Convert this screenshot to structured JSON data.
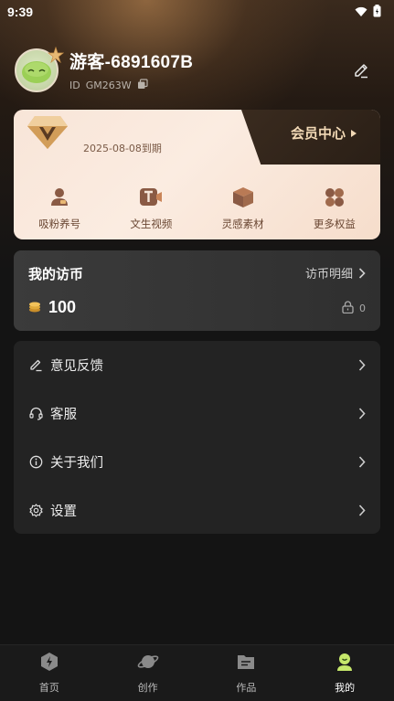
{
  "status_bar": {
    "time": "9:39"
  },
  "profile": {
    "username": "游客-6891607B",
    "id_label": "ID",
    "id_value": "GM263W"
  },
  "vip": {
    "center_label": "会员中心",
    "expire": "2025-08-08到期",
    "features": [
      {
        "label": "吸粉养号",
        "icon": "user-card-icon"
      },
      {
        "label": "文生视频",
        "icon": "text-video-icon"
      },
      {
        "label": "灵感素材",
        "icon": "box-icon"
      },
      {
        "label": "更多权益",
        "icon": "clover-icon"
      }
    ]
  },
  "coins": {
    "title": "我的访币",
    "detail": "访币明细",
    "amount": "100",
    "locked": "0"
  },
  "menu": [
    {
      "label": "意见反馈",
      "icon": "pen-icon"
    },
    {
      "label": "客服",
      "icon": "headset-icon"
    },
    {
      "label": "关于我们",
      "icon": "info-icon"
    },
    {
      "label": "设置",
      "icon": "gear-icon"
    }
  ],
  "tabs": [
    {
      "label": "首页",
      "icon": "home-lightning-icon",
      "active": false
    },
    {
      "label": "创作",
      "icon": "planet-icon",
      "active": false
    },
    {
      "label": "作品",
      "icon": "folder-icon",
      "active": false
    },
    {
      "label": "我的",
      "icon": "profile-icon",
      "active": true
    }
  ],
  "colors": {
    "accent_gold": "#f2d9b6",
    "vip_card_bg": "#fbece1",
    "coin_color": "#e0a93a",
    "active_tab": "#c6e86b"
  }
}
